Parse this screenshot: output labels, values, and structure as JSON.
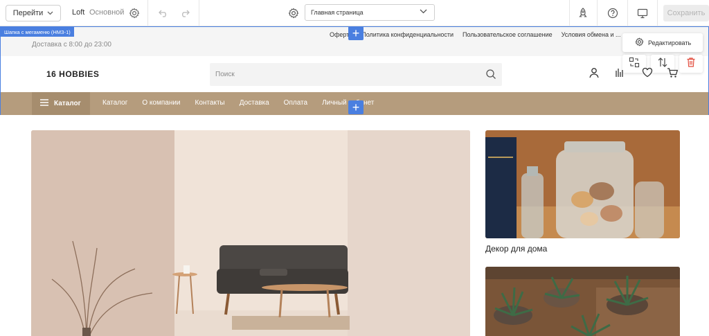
{
  "toolbar": {
    "go_label": "Перейти",
    "theme_name": "Loft",
    "theme_variant": "Основной",
    "page_select_value": "Главная страница",
    "save_label": "Сохранить"
  },
  "section": {
    "tag": "Шапка с мегаменю (НМЗ-1)",
    "edit_label": "Редактировать"
  },
  "site": {
    "delivery": "Доставка с 8:00 до 23:00",
    "top_links": [
      "Оферта",
      "Политика конфиденциальности",
      "Пользовательское соглашение",
      "Условия обмена и ..."
    ],
    "logo": "16 HOBBIES",
    "search_placeholder": "Поиск",
    "catalog_button": "Каталог",
    "nav": [
      "Каталог",
      "О компании",
      "Контакты",
      "Доставка",
      "Оплата",
      "Личный кабинет"
    ]
  },
  "content": {
    "card1_title": "Декор для дома"
  },
  "colors": {
    "accent": "#4a7fe0",
    "nav_bg": "#b59c7d",
    "catalog_bg": "#a68d6e",
    "delete_red": "#e24a3b"
  },
  "icons": [
    "chevron-down-icon",
    "gear-icon",
    "undo-icon",
    "redo-icon",
    "rocket-icon",
    "help-icon",
    "monitor-icon",
    "user-icon",
    "compare-icon",
    "heart-icon",
    "cart-icon",
    "search-icon",
    "swap-icon",
    "sort-icon",
    "trash-icon",
    "menu-icon",
    "plus-icon"
  ]
}
